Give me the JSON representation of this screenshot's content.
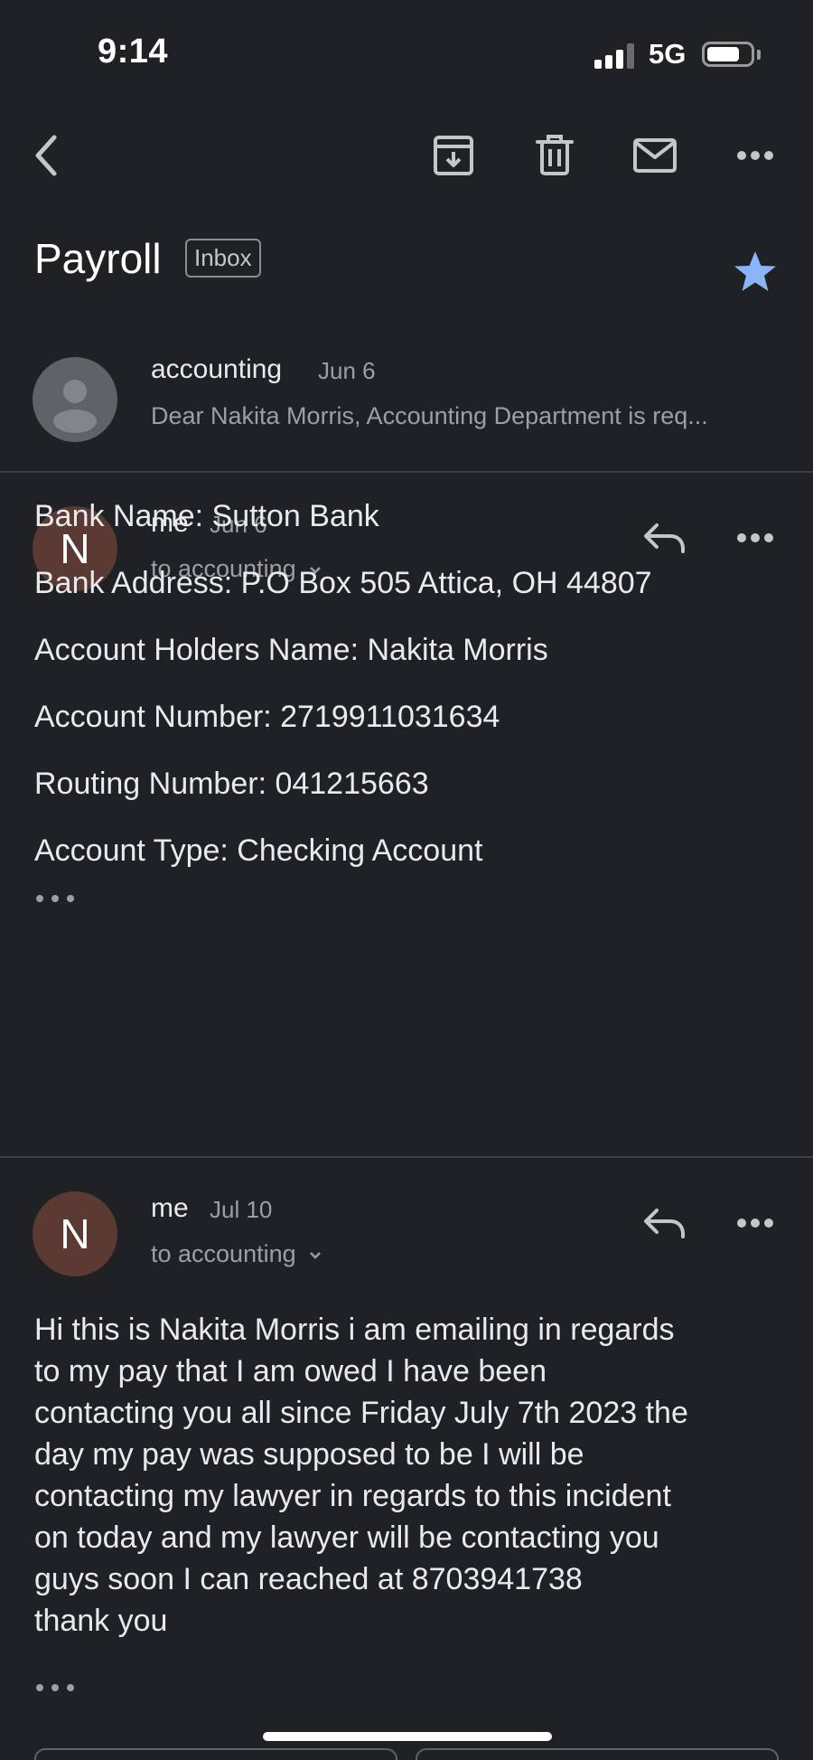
{
  "status_bar": {
    "time": "9:14",
    "network": "5G",
    "signal_bars_active": 3,
    "signal_bars_total": 4,
    "battery_level": 0.75
  },
  "toolbar": {
    "back_icon": "back-arrow-icon",
    "archive_icon": "archive-icon",
    "delete_icon": "trash-icon",
    "mark_unread_icon": "mail-icon",
    "more_icon": "more-horizontal-icon"
  },
  "thread": {
    "subject": "Payroll",
    "label": "Inbox",
    "starred": true,
    "star_color": "#8ab4f8"
  },
  "messages": [
    {
      "sender": "accounting",
      "date": "Jun 6",
      "snippet": "Dear Nakita Morris, Accounting Department is req..."
    },
    {
      "sender": "me",
      "avatar_letter": "N",
      "date": "Jun 6",
      "recipients": "to accounting",
      "body": [
        "Bank Name: Sutton Bank",
        "Bank Address: P.O Box 505 Attica, OH 44807",
        "Account Holders Name: Nakita Morris",
        "Account Number: 2719911031634",
        "Routing Number: 041215663",
        "Account Type: Checking Account"
      ]
    },
    {
      "sender": "me",
      "avatar_letter": "N",
      "date": "Jul 10",
      "recipients": "to accounting",
      "body_lines": [
        "Hi this is Nakita Morris i am emailing in regards",
        "to my pay that I am owed I have been",
        "contacting you all since Friday July 7th 2023 the",
        "day my pay was supposed to be I will be",
        "contacting my lawyer in regards to this incident",
        "on today and my lawyer will be contacting you",
        "guys soon I can reached at 8703941738",
        "thank you"
      ]
    }
  ],
  "colors": {
    "background": "#202124",
    "avatar_me": "#5a3a33",
    "avatar_default": "#5f6368",
    "secondary_text": "#9aa0a6"
  }
}
